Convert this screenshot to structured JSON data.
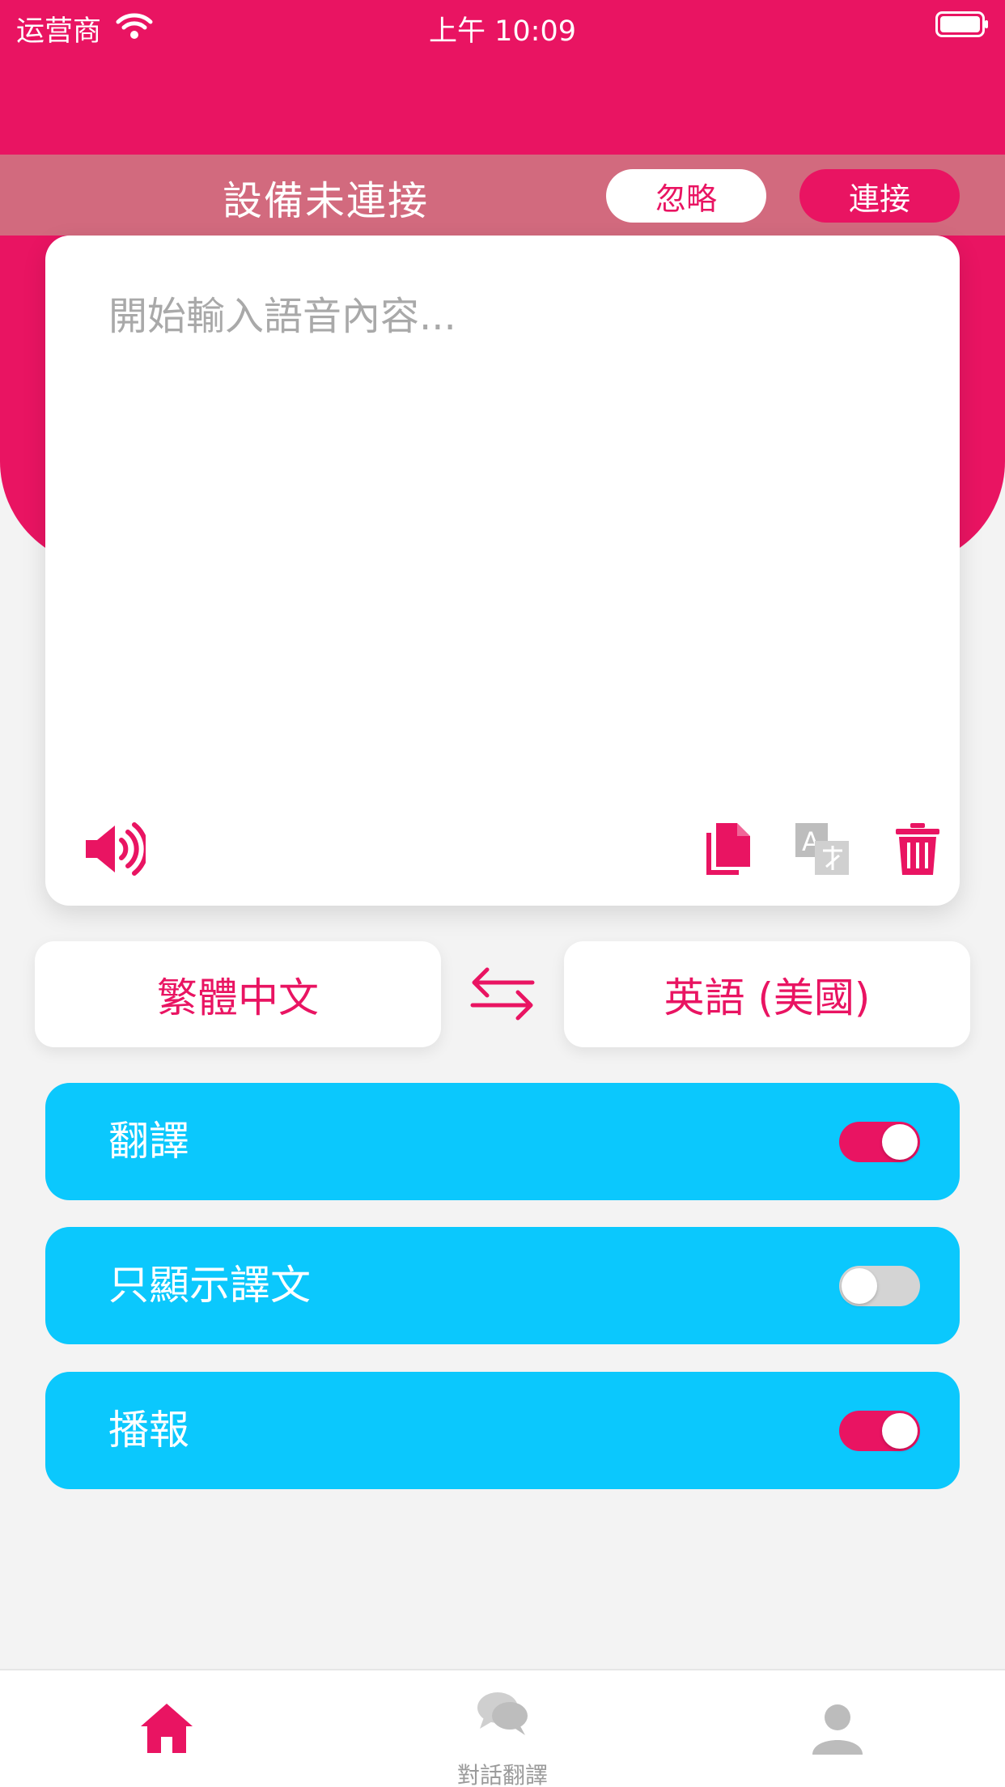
{
  "status_bar": {
    "carrier": "运营商",
    "time": "上午 10:09"
  },
  "device_banner": {
    "message": "設備未連接",
    "ignore_label": "忽略",
    "connect_label": "連接"
  },
  "input_card": {
    "placeholder": "開始輸入語音內容...",
    "value": "",
    "icons": [
      "speaker-icon",
      "copy-icon",
      "translate-icon",
      "trash-icon"
    ]
  },
  "languages": {
    "source": "繁體中文",
    "target": "英語 (美國)",
    "swap_icon": "swap-arrows-icon"
  },
  "options": [
    {
      "label": "翻譯",
      "enabled": true
    },
    {
      "label": "只顯示譯文",
      "enabled": false
    },
    {
      "label": "播報",
      "enabled": true
    }
  ],
  "tabbar": {
    "home_icon": "home-icon",
    "chat_label": "對話翻譯",
    "chat_icon": "chat-bubbles-icon",
    "profile_icon": "user-icon"
  },
  "colors": {
    "brand": "#e91462",
    "banner": "#d26a7e",
    "option_bg": "#0bc8fd",
    "background": "#f3f3f3"
  }
}
